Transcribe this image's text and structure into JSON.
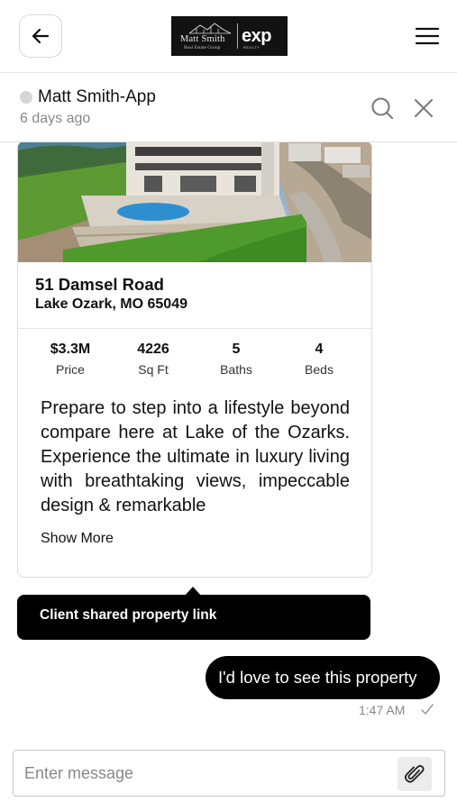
{
  "header": {
    "logo": {
      "brand_name": "Matt Smith",
      "brand_sub": "Real Estate Group",
      "exp_text": "exp",
      "exp_sub": "REALTY"
    },
    "back_icon": "arrow-left-icon",
    "menu_icon": "hamburger-menu-icon"
  },
  "chat_header": {
    "contact_name": "Matt Smith-App",
    "last_seen": "6 days ago",
    "status_color": "#d6d6d6",
    "search_icon": "search-icon",
    "close_icon": "close-icon"
  },
  "property_card": {
    "street": "51 Damsel Road",
    "city": "Lake Ozark, MO 65049",
    "stats": [
      {
        "value": "$3.3M",
        "label": "Price"
      },
      {
        "value": "4226",
        "label": "Sq Ft"
      },
      {
        "value": "5",
        "label": "Baths"
      },
      {
        "value": "4",
        "label": "Beds"
      }
    ],
    "description": "Prepare to step into a lifestyle beyond compare here at Lake of the Ozarks. Experience the ultimate in luxury living with breathtaking views, impeccable design & remarkable",
    "show_more": "Show More"
  },
  "notice": {
    "text": "Client shared property link"
  },
  "outgoing_message": {
    "text": "I'd love to see this property",
    "time": "1:47 AM",
    "status_icon": "check-icon"
  },
  "composer": {
    "placeholder": "Enter message",
    "value": "",
    "attach_icon": "paperclip-icon"
  },
  "colors": {
    "accent": "#000000",
    "muted_text": "#888888",
    "border": "#dcdcdc"
  }
}
